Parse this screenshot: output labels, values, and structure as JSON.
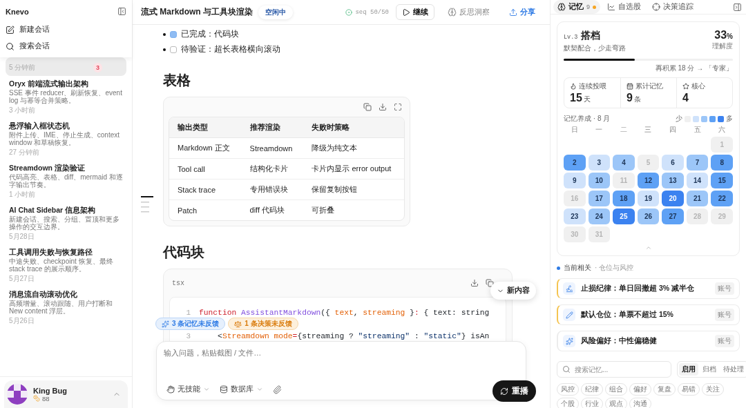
{
  "sidebar": {
    "brand": "Knevo",
    "actions": [
      {
        "kind": "new",
        "label": "新建会话"
      },
      {
        "kind": "search",
        "label": "搜索会话"
      }
    ],
    "conversations": [
      {
        "time": "5 分钟前",
        "badge": "3",
        "selected": true
      },
      {
        "title": "Oryx 前端流式输出架构",
        "summary": "SSE 事件 reducer、刷新恢复、event log 与幂等合并策略。",
        "time": "3 小时前",
        "selected": false
      },
      {
        "title": "悬浮输入框状态机",
        "summary": "附件上传、IME、停止生成、context window 和草稿恢复。",
        "time": "27 分钟前",
        "selected": false
      },
      {
        "title": "Streamdown 渲染验证",
        "summary": "代码高亮、表格、diff、mermaid 和逐字输出节奏。",
        "time": "1 小时前",
        "selected": false
      },
      {
        "title": "AI Chat Sidebar 信息架构",
        "summary": "新建会话、搜索、分组、置顶和更多操作的交互边界。",
        "time": "5月28日",
        "selected": false
      },
      {
        "title": "工具调用失败与恢复路径",
        "summary": "中途失败、checkpoint 恢复、最终 stack trace 的展示顺序。",
        "time": "5月27日",
        "selected": false
      },
      {
        "title": "消息流自动滚动优化",
        "summary": "高频增量、滚动跟随、用户打断和 New content 浮层。",
        "time": "5月26日",
        "selected": false
      }
    ],
    "user": {
      "name": "King Bug",
      "points": "88"
    }
  },
  "header": {
    "title": "流式 Markdown 与工具块渲染",
    "status": "空闲中",
    "seq": "seq 50/50",
    "actions": [
      {
        "kind": "play",
        "label": "继续"
      },
      {
        "kind": "insight",
        "label": "反思洞察"
      },
      {
        "kind": "share",
        "label": "分享"
      }
    ]
  },
  "content": {
    "tasks": [
      {
        "text": "已完成：代码块",
        "checked": true
      },
      {
        "text": "待验证：超长表格横向滚动",
        "checked": false
      }
    ],
    "table_heading": "表格",
    "table": {
      "columns": [
        "输出类型",
        "推荐渲染",
        "失败时策略"
      ],
      "rows": [
        [
          "Markdown 正文",
          "Streamdown",
          "降级为纯文本"
        ],
        [
          "Tool call",
          "结构化卡片",
          "卡片内显示 error output"
        ],
        [
          "Stack trace",
          "专用错误块",
          "保留复制按钮"
        ],
        [
          "Patch",
          "diff 代码块",
          "可折叠"
        ]
      ]
    },
    "code_heading": "代码块",
    "code": {
      "language": "tsx",
      "lines": [
        {
          "number": "1",
          "tokens": [
            {
              "kind": "keyword",
              "text": "function "
            },
            {
              "kind": "function",
              "text": "AssistantMarkdown"
            },
            {
              "kind": "plain",
              "text": "({ "
            },
            {
              "kind": "param",
              "text": "text"
            },
            {
              "kind": "plain",
              "text": ", "
            },
            {
              "kind": "param",
              "text": "streaming"
            },
            {
              "kind": "plain",
              "text": " }"
            },
            {
              "kind": "keyword",
              "text": ":"
            },
            {
              "kind": "plain",
              "text": " { text: string"
            }
          ]
        },
        {
          "number": "3",
          "tokens": [
            {
              "kind": "plain",
              "text": "    <"
            },
            {
              "kind": "tag",
              "text": "Streamdown mode"
            },
            {
              "kind": "keyword",
              "text": "="
            },
            {
              "kind": "plain",
              "text": "{streaming ? "
            },
            {
              "kind": "string",
              "text": "\"streaming\""
            },
            {
              "kind": "plain",
              "text": " : "
            },
            {
              "kind": "string",
              "text": "\"static\""
            },
            {
              "kind": "plain",
              "text": "} isAn"
            }
          ]
        }
      ]
    }
  },
  "new_content": "新内容",
  "feedback_chips": [
    {
      "kind": "memory",
      "label": "3 条记忆未反馈"
    },
    {
      "kind": "decision",
      "label": "1 条决策未反馈"
    }
  ],
  "composer": {
    "placeholder": "输入问题，粘贴截图 / 文件…",
    "tools": [
      {
        "kind": "skill",
        "label": "无技能"
      },
      {
        "kind": "database",
        "label": "数据库"
      }
    ],
    "replay": "重播"
  },
  "memory_panel": {
    "tabs": [
      {
        "kind": "memory",
        "label": "记忆",
        "count": "9",
        "selected": true
      },
      {
        "kind": "stocks",
        "label": "自选股",
        "selected": false
      },
      {
        "kind": "decisions",
        "label": "决策追踪",
        "selected": false
      }
    ],
    "level_card": {
      "rank": "Lv.3",
      "title": "搭档",
      "subtitle": "默契配合，少走弯路",
      "percent": "33",
      "percent_unit": "%",
      "percent_label": "理解度",
      "progress": {
        "level": 0.42
      },
      "next": "再积累 18 分 → 「专家」"
    },
    "stats": [
      {
        "kind": "streak",
        "label": "连续投喂",
        "value": "15",
        "unit": "天"
      },
      {
        "kind": "total",
        "label": "累计记忆",
        "value": "9",
        "unit": "条"
      },
      {
        "kind": "core",
        "label": "核心",
        "value": "4"
      }
    ],
    "calendar": {
      "title": "记忆养成 · 8 月",
      "legend_low": "少",
      "legend_high": "多",
      "legend": [
        {
          "color": "#f0f0f0"
        },
        {
          "color": "#cfe2fb"
        },
        {
          "color": "#9cc6f8"
        },
        {
          "color": "#5ea1f5"
        },
        {
          "color": "#3b82f0"
        }
      ],
      "weekdays": [
        "日",
        "一",
        "二",
        "三",
        "四",
        "五",
        "六"
      ],
      "days": [
        {
          "kind": "blank"
        },
        {
          "kind": "blank"
        },
        {
          "kind": "blank"
        },
        {
          "kind": "blank"
        },
        {
          "kind": "blank"
        },
        {
          "kind": "blank"
        },
        {
          "kind": "day",
          "label": "1",
          "color": "#f0f0f0"
        },
        {
          "kind": "day",
          "label": "2",
          "color": "#5ea1f5"
        },
        {
          "kind": "day",
          "label": "3",
          "color": "#cfe2fb"
        },
        {
          "kind": "day",
          "label": "4",
          "color": "#9cc6f8"
        },
        {
          "kind": "day",
          "label": "5",
          "color": "#f0f0f0"
        },
        {
          "kind": "day",
          "label": "6",
          "color": "#cfe2fb"
        },
        {
          "kind": "day",
          "label": "7",
          "color": "#9cc6f8"
        },
        {
          "kind": "day",
          "label": "8",
          "color": "#5ea1f5"
        },
        {
          "kind": "day",
          "label": "9",
          "color": "#cfe2fb"
        },
        {
          "kind": "day",
          "label": "10",
          "color": "#9cc6f8"
        },
        {
          "kind": "day",
          "label": "11",
          "color": "#f0f0f0"
        },
        {
          "kind": "day",
          "label": "12",
          "color": "#5ea1f5"
        },
        {
          "kind": "day",
          "label": "13",
          "color": "#9cc6f8"
        },
        {
          "kind": "day",
          "label": "14",
          "color": "#cfe2fb"
        },
        {
          "kind": "day",
          "label": "15",
          "color": "#5ea1f5"
        },
        {
          "kind": "day",
          "label": "16",
          "color": "#f0f0f0"
        },
        {
          "kind": "day",
          "label": "17",
          "color": "#9cc6f8"
        },
        {
          "kind": "day",
          "label": "18",
          "color": "#5ea1f5"
        },
        {
          "kind": "day",
          "label": "19",
          "color": "#cfe2fb"
        },
        {
          "kind": "day",
          "label": "20",
          "color": "#3b82f0"
        },
        {
          "kind": "day",
          "label": "21",
          "color": "#9cc6f8"
        },
        {
          "kind": "day",
          "label": "22",
          "color": "#5ea1f5"
        },
        {
          "kind": "day",
          "label": "23",
          "color": "#cfe2fb"
        },
        {
          "kind": "day",
          "label": "24",
          "color": "#9cc6f8"
        },
        {
          "kind": "day",
          "label": "25",
          "color": "#3b82f0"
        },
        {
          "kind": "day",
          "label": "26",
          "color": "#9cc6f8"
        },
        {
          "kind": "day",
          "label": "27",
          "color": "#5ea1f5"
        },
        {
          "kind": "day",
          "label": "28",
          "color": "#f0f0f0"
        },
        {
          "kind": "day",
          "label": "29",
          "color": "#f0f0f0"
        },
        {
          "kind": "day",
          "label": "30",
          "color": "#f0f0f0"
        },
        {
          "kind": "day",
          "label": "31",
          "color": "#f0f0f0"
        }
      ]
    },
    "related": {
      "title": "当前相关",
      "subtitle": "· 仓位与风控",
      "items": [
        {
          "kind": "signature",
          "text": "止损纪律：单日回撤超 3% 减半仓",
          "tag": "账号",
          "flagged": true
        },
        {
          "kind": "pencil",
          "text": "默认仓位：单票不超过 15%",
          "tag": "账号",
          "flagged": true
        },
        {
          "kind": "sparkle",
          "text": "风险偏好：中性偏稳健",
          "tag": "账号",
          "flagged": false
        }
      ]
    },
    "search": {
      "placeholder": "搜索记忆..."
    },
    "filters": [
      {
        "label": "启用",
        "selected": true
      },
      {
        "label": "归档",
        "selected": false
      },
      {
        "label": "待处理",
        "selected": false
      }
    ],
    "tags": [
      "风控",
      "纪律",
      "组合",
      "偏好",
      "复盘",
      "易错",
      "关注",
      "个股",
      "行业",
      "观点",
      "沟通"
    ]
  }
}
